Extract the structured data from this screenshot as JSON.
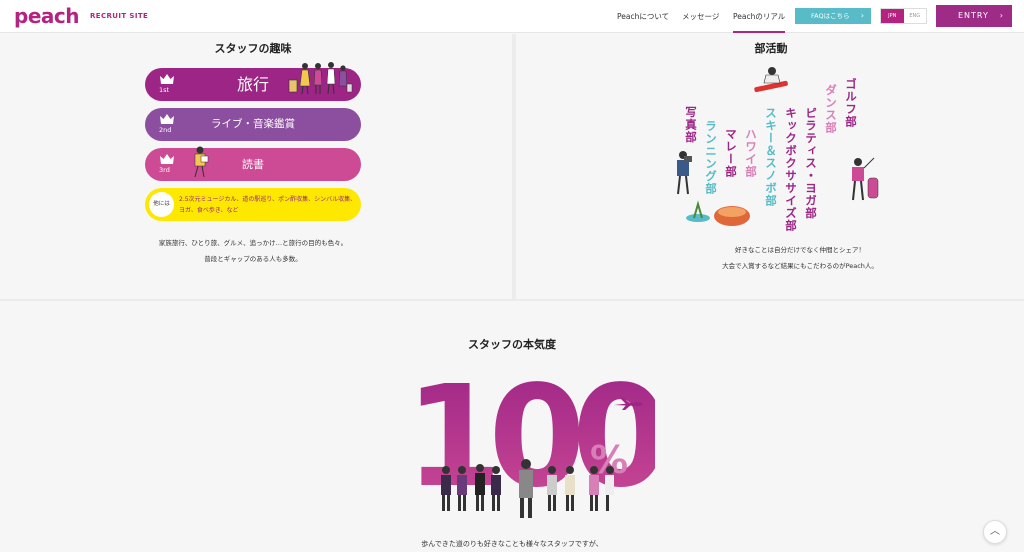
{
  "header": {
    "logo": "peach",
    "site_label": "RECRUIT SITE",
    "nav": [
      "Peachについて",
      "メッセージ",
      "Peachのリアル"
    ],
    "faq": "FAQはこちら",
    "lang": [
      "JPN",
      "ENG"
    ],
    "entry": "ENTRY"
  },
  "hobbies": {
    "title": "スタッフの趣味",
    "ranks": [
      {
        "rank": "1st",
        "label": "旅行"
      },
      {
        "rank": "2nd",
        "label": "ライブ・音楽鑑賞"
      },
      {
        "rank": "3rd",
        "label": "読書"
      }
    ],
    "other_label": "他には",
    "other_text": "2.5次元ミュージカル、道の駅巡り、ポン酢収集、シンバル収集、ヨガ、食べ歩き、など",
    "desc1": "家族旅行、ひとり旅、グルメ、追っかけ…と旅行の目的も色々。",
    "desc2": "普段とギャップのある人も多数。"
  },
  "clubs": {
    "title": "部活動",
    "items": [
      "ゴルフ部",
      "ダンス部",
      "ピラティス・ヨガ部",
      "キックボクササイズ部",
      "スキー＆スノボ部",
      "ハワイ部",
      "マレー部",
      "ランニング部",
      "写真部"
    ],
    "desc1": "好きなことは自分だけでなく仲間とシェア！",
    "desc2": "大会で入賞するなど結果にもこだわるのがPeach人。"
  },
  "motivation": {
    "title": "スタッフの本気度",
    "number": "100",
    "unit": "%",
    "desc": "歩んできた道のりも好きなことも様々なスタッフですが、"
  },
  "colors": {
    "brand": "#b4237f",
    "teal": "#57bcc7",
    "yellow": "#ffe800"
  }
}
